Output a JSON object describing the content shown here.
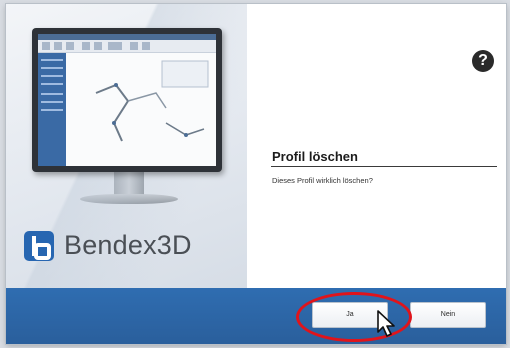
{
  "branding": {
    "logo_text": "Bendex3D"
  },
  "dialog": {
    "title": "Profil löschen",
    "message": "Dieses Profil wirklich löschen?",
    "help_icon_glyph": "?"
  },
  "buttons": {
    "yes_label": "Ja",
    "no_label": "Nein"
  },
  "colors": {
    "footer": "#2f6db1",
    "logo": "#2766b1",
    "highlight": "#e0141b"
  },
  "icons": {
    "help": "question-circle-icon",
    "cursor": "mouse-pointer-icon"
  }
}
